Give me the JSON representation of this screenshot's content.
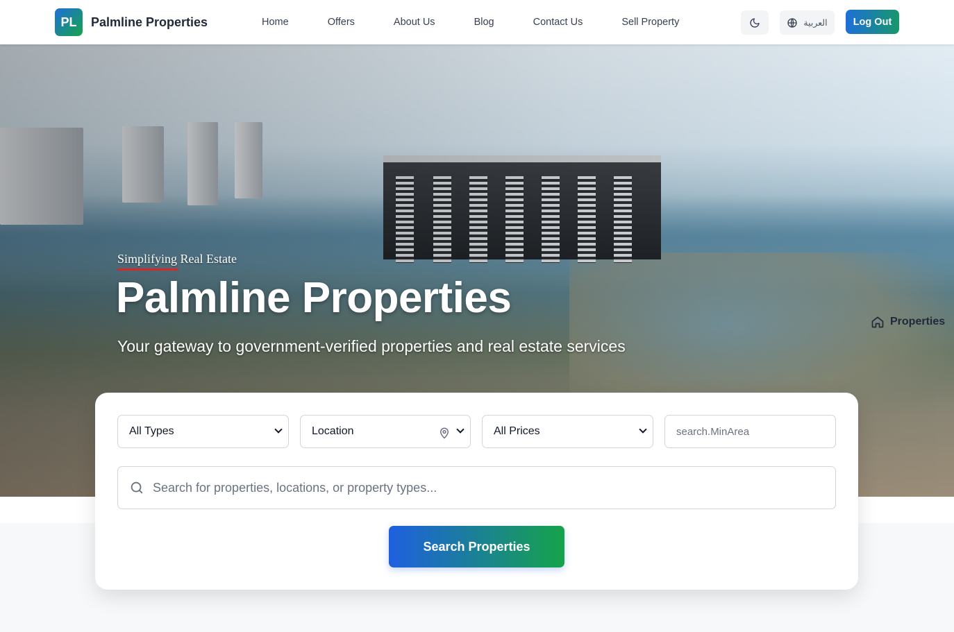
{
  "brand": {
    "logo_text": "PL",
    "name": "Palmline Properties"
  },
  "nav": {
    "links": [
      "Home",
      "Offers",
      "About Us",
      "Blog",
      "Contact Us",
      "Sell Property"
    ],
    "language_label": "العربية",
    "logout_label": "Log Out",
    "theme_icon": "moon-icon",
    "language_icon": "globe-icon"
  },
  "hero": {
    "tagline": "Simplifying Real Estate",
    "title": "Palmline Properties",
    "subtitle": "Your gateway to government-verified properties and real estate services",
    "side_link": "Properties",
    "side_link_icon": "home-icon"
  },
  "search": {
    "type_select": "All Types",
    "location_select": "Location",
    "price_select": "All Prices",
    "min_area_placeholder": "search.MinArea",
    "query_placeholder": "Search for properties, locations, or property types...",
    "submit_label": "Search Properties"
  },
  "colors": {
    "brand_blue": "#1e6fd9",
    "brand_green": "#16a34a",
    "tag_underline": "#dc2626"
  }
}
